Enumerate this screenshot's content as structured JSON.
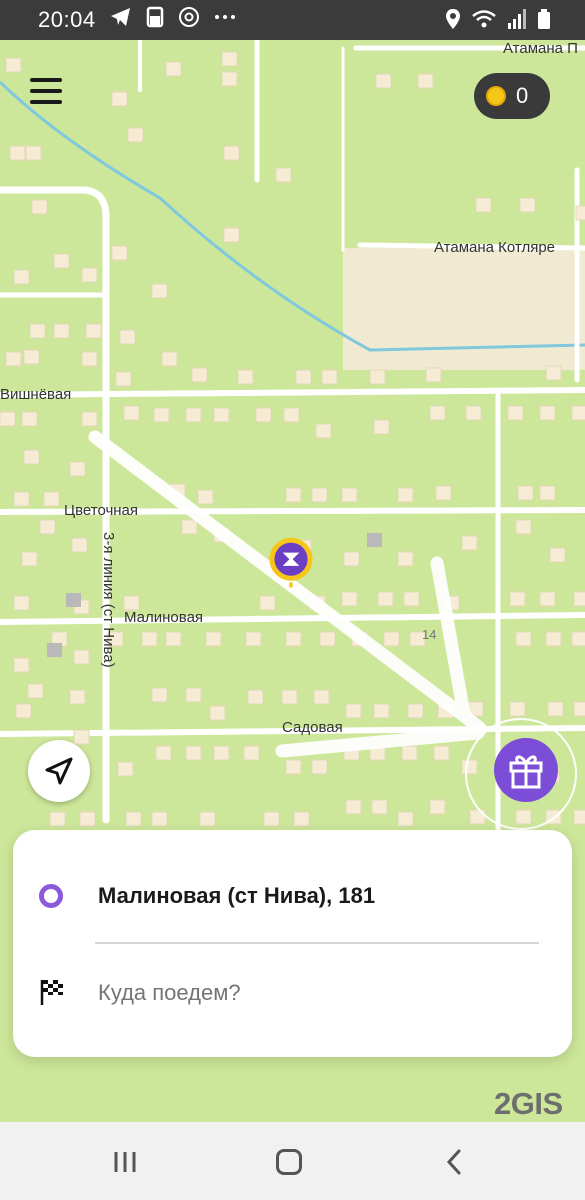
{
  "status_bar": {
    "time": "20:04"
  },
  "map": {
    "streets": {
      "atamana_p": "Атамана П",
      "atamana_kotlyare": "Атамана Котляре",
      "vishnevaya": "Вишнёвая",
      "tsvetochnaya": "Цветочная",
      "line3": "3-я линия (ст Нива)",
      "malinovaya": "Малиновая",
      "sadovaya": "Садовая"
    },
    "house_number": "14"
  },
  "coins": {
    "value": "0"
  },
  "route": {
    "origin": "Малиновая (ст Нива), 181",
    "destination_placeholder": "Куда поедем?"
  },
  "watermark": "2GIS",
  "colors": {
    "accent": "#8c5ad9",
    "map_bg": "#cde79a",
    "pin_yellow": "#f5c518"
  }
}
